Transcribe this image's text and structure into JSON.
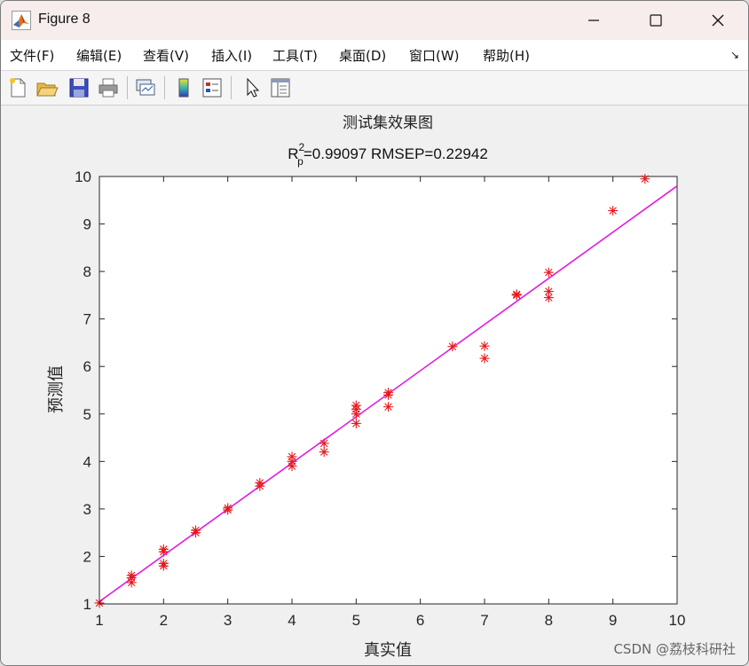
{
  "window": {
    "title": "Figure 8",
    "icon": "matlab-logo-icon"
  },
  "menu": [
    "文件(F)",
    "编辑(E)",
    "查看(V)",
    "插入(I)",
    "工具(T)",
    "桌面(D)",
    "窗口(W)",
    "帮助(H)"
  ],
  "toolbar": [
    "new-figure-icon",
    "open-file-icon",
    "save-icon",
    "print-icon",
    "link-plot-icon",
    "colorbar-icon",
    "legend-icon",
    "pointer-icon",
    "property-editor-icon"
  ],
  "colors": {
    "marker": "#e8161b",
    "fit_line": "#e21be2",
    "axes_bg": "#ffffff"
  },
  "chart_data": {
    "type": "scatter",
    "title": "测试集效果图",
    "subtitle": {
      "r": "R",
      "sup": "2",
      "sub": "p",
      "rest": "=0.99097  RMSEP=0.22942"
    },
    "xlabel": "真实值",
    "ylabel": "预测值",
    "xlim": [
      1,
      10
    ],
    "ylim": [
      1,
      10
    ],
    "xticks": [
      1,
      2,
      3,
      4,
      5,
      6,
      7,
      8,
      9,
      10
    ],
    "yticks": [
      1,
      2,
      3,
      4,
      5,
      6,
      7,
      8,
      9,
      10
    ],
    "marker": "asterisk",
    "grid": false,
    "fit_line": {
      "x": [
        1,
        10
      ],
      "y": [
        1.05,
        9.8
      ]
    },
    "points": [
      {
        "x": 1,
        "y": 1.02
      },
      {
        "x": 1.5,
        "y": 1.45
      },
      {
        "x": 1.5,
        "y": 1.55
      },
      {
        "x": 1.5,
        "y": 1.6
      },
      {
        "x": 2,
        "y": 1.8
      },
      {
        "x": 2,
        "y": 1.85
      },
      {
        "x": 2,
        "y": 2.1
      },
      {
        "x": 2,
        "y": 2.15
      },
      {
        "x": 2.5,
        "y": 2.5
      },
      {
        "x": 2.5,
        "y": 2.55
      },
      {
        "x": 3,
        "y": 2.98
      },
      {
        "x": 3,
        "y": 3.02
      },
      {
        "x": 3.5,
        "y": 3.48
      },
      {
        "x": 3.5,
        "y": 3.55
      },
      {
        "x": 4,
        "y": 3.9
      },
      {
        "x": 4,
        "y": 4.0
      },
      {
        "x": 4,
        "y": 4.1
      },
      {
        "x": 4.5,
        "y": 4.2
      },
      {
        "x": 4.5,
        "y": 4.38
      },
      {
        "x": 5,
        "y": 4.8
      },
      {
        "x": 5,
        "y": 5.0
      },
      {
        "x": 5,
        "y": 5.1
      },
      {
        "x": 5,
        "y": 5.18
      },
      {
        "x": 5.5,
        "y": 5.15
      },
      {
        "x": 5.5,
        "y": 5.4
      },
      {
        "x": 5.5,
        "y": 5.45
      },
      {
        "x": 6.5,
        "y": 6.42
      },
      {
        "x": 7,
        "y": 6.17
      },
      {
        "x": 7,
        "y": 6.43
      },
      {
        "x": 7.5,
        "y": 7.5
      },
      {
        "x": 7.5,
        "y": 7.52
      },
      {
        "x": 8,
        "y": 7.45
      },
      {
        "x": 8,
        "y": 7.58
      },
      {
        "x": 8,
        "y": 7.98
      },
      {
        "x": 9,
        "y": 9.28
      },
      {
        "x": 9.5,
        "y": 9.95
      }
    ]
  },
  "watermark": "CSDN @荔枝科研社"
}
